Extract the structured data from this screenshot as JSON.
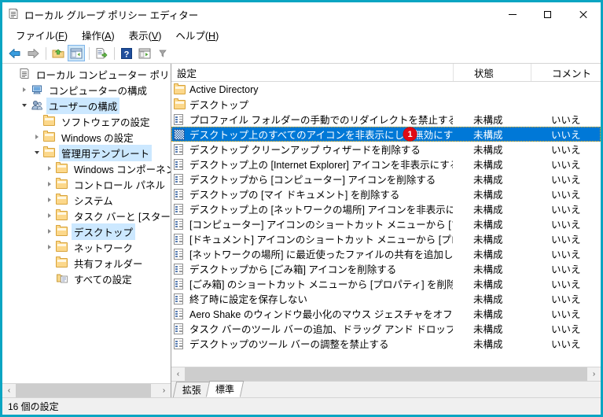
{
  "window": {
    "title": "ローカル グループ ポリシー エディター",
    "title_icon": "policy-editor-icon",
    "accent_color": "#0aa5c2",
    "controls": {
      "minimize": "minimize-icon",
      "maximize": "maximize-icon",
      "close": "close-icon"
    }
  },
  "menubar": {
    "items": [
      {
        "label": "ファイル(F)",
        "text": "ファイル(",
        "accel": "F",
        "tail": ")"
      },
      {
        "label": "操作(A)",
        "text": "操作(",
        "accel": "A",
        "tail": ")"
      },
      {
        "label": "表示(V)",
        "text": "表示(",
        "accel": "V",
        "tail": ")"
      },
      {
        "label": "ヘルプ(H)",
        "text": "ヘルプ(",
        "accel": "H",
        "tail": ")"
      }
    ]
  },
  "toolbar": {
    "buttons": [
      {
        "name": "back-icon"
      },
      {
        "name": "forward-icon"
      },
      {
        "name": "separator"
      },
      {
        "name": "up-folder-icon"
      },
      {
        "name": "show-hide-tree-icon",
        "selected": true
      },
      {
        "name": "separator"
      },
      {
        "name": "export-list-icon"
      },
      {
        "name": "separator"
      },
      {
        "name": "help-icon"
      },
      {
        "name": "show-console-icon"
      },
      {
        "name": "filter-icon"
      }
    ]
  },
  "tree": {
    "items": [
      {
        "label": "ローカル コンピューター ポリシー",
        "indent": 0,
        "twist": "none",
        "icon": "policy-root-icon",
        "selected": false
      },
      {
        "label": "コンピューターの構成",
        "indent": 1,
        "twist": "right",
        "icon": "computer-config-icon",
        "selected": false
      },
      {
        "label": "ユーザーの構成",
        "indent": 1,
        "twist": "down",
        "icon": "user-config-icon",
        "selected": true
      },
      {
        "label": "ソフトウェアの設定",
        "indent": 2,
        "twist": "none",
        "icon": "folder-icon",
        "selected": false
      },
      {
        "label": "Windows の設定",
        "indent": 2,
        "twist": "right",
        "icon": "folder-icon",
        "selected": false
      },
      {
        "label": "管理用テンプレート",
        "indent": 2,
        "twist": "down",
        "icon": "folder-icon",
        "selected": true
      },
      {
        "label": "Windows コンポーネント",
        "indent": 3,
        "twist": "right",
        "icon": "folder-icon",
        "selected": false
      },
      {
        "label": "コントロール パネル",
        "indent": 3,
        "twist": "right",
        "icon": "folder-icon",
        "selected": false
      },
      {
        "label": "システム",
        "indent": 3,
        "twist": "right",
        "icon": "folder-icon",
        "selected": false
      },
      {
        "label": "タスク バーと [スタート] メニュー",
        "indent": 3,
        "twist": "right",
        "icon": "folder-icon",
        "selected": false
      },
      {
        "label": "デスクトップ",
        "indent": 3,
        "twist": "right",
        "icon": "folder-icon",
        "selected": true
      },
      {
        "label": "ネットワーク",
        "indent": 3,
        "twist": "right",
        "icon": "folder-icon",
        "selected": false
      },
      {
        "label": "共有フォルダー",
        "indent": 3,
        "twist": "none",
        "icon": "folder-icon",
        "selected": false
      },
      {
        "label": "すべての設定",
        "indent": 3,
        "twist": "none",
        "icon": "all-settings-icon",
        "selected": false
      }
    ]
  },
  "list": {
    "columns": [
      {
        "label": "設定",
        "name": "setting"
      },
      {
        "label": "状態",
        "name": "state"
      },
      {
        "label": "コメント",
        "name": "comment"
      }
    ],
    "rows": [
      {
        "icon": "folder-icon",
        "name": "Active Directory",
        "state": "",
        "comment": "",
        "selected": false
      },
      {
        "icon": "folder-icon",
        "name": "デスクトップ",
        "state": "",
        "comment": "",
        "selected": false
      },
      {
        "icon": "policy-icon",
        "name": "プロファイル フォルダーの手動でのリダイレクトを禁止する",
        "state": "未構成",
        "comment": "いいえ",
        "selected": false
      },
      {
        "icon": "policy-selected-icon",
        "name": "デスクトップ上のすべてのアイコンを非表示にして無効にする",
        "state": "未構成",
        "comment": "いいえ",
        "selected": true,
        "badge": "1"
      },
      {
        "icon": "policy-icon",
        "name": "デスクトップ クリーンアップ ウィザードを削除する",
        "state": "未構成",
        "comment": "いいえ",
        "selected": false
      },
      {
        "icon": "policy-icon",
        "name": "デスクトップ上の [Internet Explorer] アイコンを非表示にする",
        "state": "未構成",
        "comment": "いいえ",
        "selected": false
      },
      {
        "icon": "policy-icon",
        "name": "デスクトップから [コンピューター] アイコンを削除する",
        "state": "未構成",
        "comment": "いいえ",
        "selected": false
      },
      {
        "icon": "policy-icon",
        "name": "デスクトップの [マイ ドキュメント] を削除する",
        "state": "未構成",
        "comment": "いいえ",
        "selected": false
      },
      {
        "icon": "policy-icon",
        "name": "デスクトップ上の [ネットワークの場所] アイコンを非表示にする",
        "state": "未構成",
        "comment": "いいえ",
        "selected": false
      },
      {
        "icon": "policy-icon",
        "name": "[コンピューター] アイコンのショートカット メニューから [プロパティ] を削",
        "state": "未構成",
        "comment": "いいえ",
        "selected": false
      },
      {
        "icon": "policy-icon",
        "name": "[ドキュメント] アイコンのショートカット メニューから [プロパティ] を削除",
        "state": "未構成",
        "comment": "いいえ",
        "selected": false
      },
      {
        "icon": "policy-icon",
        "name": "[ネットワークの場所] に最近使ったファイルの共有を追加しない",
        "state": "未構成",
        "comment": "いいえ",
        "selected": false
      },
      {
        "icon": "policy-icon",
        "name": "デスクトップから [ごみ箱] アイコンを削除する",
        "state": "未構成",
        "comment": "いいえ",
        "selected": false
      },
      {
        "icon": "policy-icon",
        "name": "[ごみ箱] のショートカット メニューから [プロパティ] を削除する",
        "state": "未構成",
        "comment": "いいえ",
        "selected": false
      },
      {
        "icon": "policy-icon",
        "name": "終了時に設定を保存しない",
        "state": "未構成",
        "comment": "いいえ",
        "selected": false
      },
      {
        "icon": "policy-icon",
        "name": "Aero Shake のウィンドウ最小化のマウス ジェスチャをオフにする",
        "state": "未構成",
        "comment": "いいえ",
        "selected": false
      },
      {
        "icon": "policy-icon",
        "name": "タスク バーのツール バーの追加、ドラッグ アンド ドロップおよび終了を...",
        "state": "未構成",
        "comment": "いいえ",
        "selected": false
      },
      {
        "icon": "policy-icon",
        "name": "デスクトップのツール バーの調整を禁止する",
        "state": "未構成",
        "comment": "いいえ",
        "selected": false
      }
    ]
  },
  "tabs": [
    {
      "label": "拡張",
      "name": "tab-extended",
      "active": false
    },
    {
      "label": "標準",
      "name": "tab-standard",
      "active": true
    }
  ],
  "statusbar": {
    "text": "16 個の設定"
  },
  "scrollbars": {
    "left_arrow": "‹",
    "right_arrow": "›"
  }
}
